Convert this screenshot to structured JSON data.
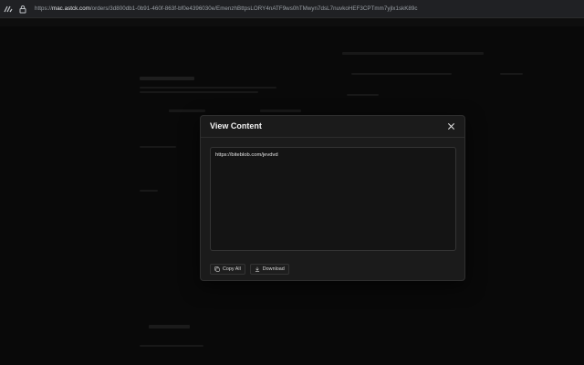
{
  "browser": {
    "url_scheme": "https://",
    "url_host": "mac.astck.com",
    "url_path": "/orders/3d800db1-0b91-460f-863f-bf0e4396030e/EmenzhBttpsLORY4nATF9ws0hTMwyn7dsL7nuvkoHEF3CPTmm7yjlx1skK89c",
    "icons": [
      "tab-icon",
      "lock-icon"
    ]
  },
  "modal": {
    "title": "View Content",
    "content": "https://biteblob.com/jevdvd",
    "copy_label": "Copy All",
    "download_label": "Download",
    "icons": [
      "close-icon",
      "copy-icon",
      "download-icon"
    ]
  },
  "colors": {
    "background": "#121212",
    "modal_bg": "#1b1b1b",
    "border": "#2f2f2f",
    "text": "#e6e6e6"
  }
}
